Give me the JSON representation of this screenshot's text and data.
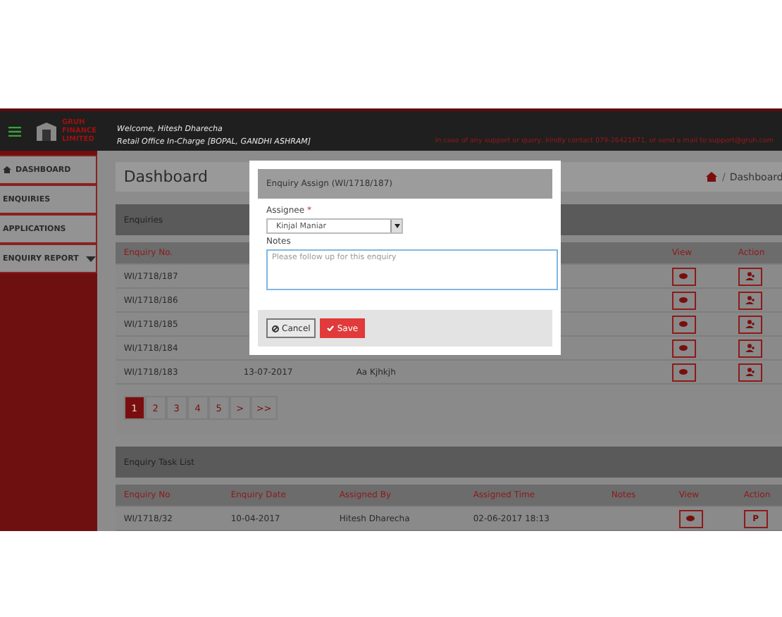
{
  "header": {
    "logo_lines": [
      "GRUH",
      "FINANCE",
      "LIMITED"
    ],
    "welcome": "Welcome, Hitesh Dharecha",
    "office": "Retail Office In-Charge [BOPAL, GANDHI ASHRAM]",
    "support": "In case of any support or query, kindly contact 079-26421671, or send a mail to support@gruh.com"
  },
  "sidebar": {
    "items": [
      {
        "label": "DASHBOARD",
        "kind": "home"
      },
      {
        "label": "ENQUIRIES",
        "kind": "link"
      },
      {
        "label": "APPLICATIONS",
        "kind": "link"
      },
      {
        "label": "ENQUIRY REPORT",
        "kind": "dropdown"
      }
    ]
  },
  "page_title": "Dashboard",
  "breadcrumb": {
    "separator": "/",
    "label": "Dashboard"
  },
  "enquiries": {
    "title": "Enquiries",
    "columns": {
      "number": "Enquiry No.",
      "view": "View",
      "action": "Action"
    },
    "rows": [
      {
        "number": "WI/1718/187"
      },
      {
        "number": "WI/1718/186"
      },
      {
        "number": "WI/1718/185"
      },
      {
        "number": "WI/1718/184"
      },
      {
        "number": "WI/1718/183",
        "date": "13-07-2017",
        "name": "Aa Kjhkjh"
      }
    ],
    "pages": [
      {
        "label": "1",
        "selected": true
      },
      {
        "label": "2",
        "selected": false
      },
      {
        "label": "3",
        "selected": false
      },
      {
        "label": "4",
        "selected": false
      },
      {
        "label": "5",
        "selected": false
      },
      {
        "label": ">",
        "selected": false
      },
      {
        "label": ">>",
        "selected": false
      }
    ]
  },
  "task_list": {
    "title": "Enquiry Task List",
    "columns": [
      "Enquiry No",
      "Enquiry Date",
      "Assigned By",
      "Assigned Time",
      "Notes",
      "View",
      "Action"
    ],
    "rows": [
      {
        "number": "WI/1718/32",
        "date": "10-04-2017",
        "assigned_by": "Hitesh Dharecha",
        "assigned_time": "02-06-2017 18:13",
        "action": "P"
      }
    ]
  },
  "modal": {
    "title": "Enquiry Assign (WI/1718/187)",
    "assignee_label": "Assignee",
    "required_mark": "*",
    "assignee": "Kinjal Maniar",
    "notes_label": "Notes",
    "notes_placeholder": "Please follow up for this enquiry",
    "cancel": "Cancel",
    "save": "Save"
  }
}
